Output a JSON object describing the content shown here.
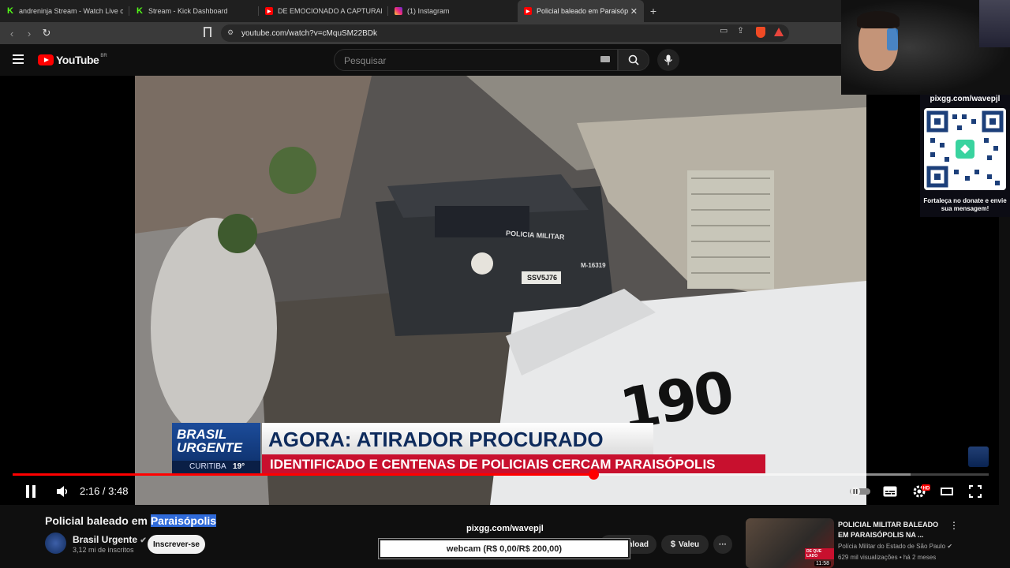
{
  "browser": {
    "tabs": [
      {
        "label": "andreninja Stream - Watch Live on K",
        "icon": "kick-icon"
      },
      {
        "label": "Stream - Kick Dashboard",
        "icon": "kick-icon"
      },
      {
        "label": "DE EMOCIONADO A CAPTURADO, A",
        "icon": "youtube-icon"
      },
      {
        "label": "(1) Instagram",
        "icon": "instagram-icon"
      },
      {
        "label": "Policial baleado em Paraisóp",
        "icon": "youtube-icon",
        "active": true
      }
    ],
    "url": "youtube.com/watch?v=cMquSM22BDk"
  },
  "youtube": {
    "logo": "YouTube",
    "region": "BR",
    "search_placeholder": "Pesquisar"
  },
  "video": {
    "lower_third": {
      "brand_line1": "BRASIL",
      "brand_line2": "URGENTE",
      "city": "CURITIBA",
      "temp": "19°",
      "headline": "AGORA: ATIRADOR PROCURADO",
      "subhead": "IDENTIFICADO E CENTENAS DE POLICIAIS CERCAM PARAISÓPOLIS"
    },
    "scene_text": {
      "car_door": "POLICIA MILITAR",
      "car_plate": "SSV5J76",
      "car_id": "M-16319",
      "car_number": "190"
    },
    "time_current": "2:16",
    "time_total": "3:48",
    "progress_fraction": 0.595,
    "buffered_fraction": 0.92
  },
  "overlay": {
    "donate_url": "pixgg.com/wavepjl",
    "donate_message": "Fortaleça no donate e envie sua mensagem!"
  },
  "below": {
    "title_plain": "Policial baleado em ",
    "title_highlight": "Paraisópolis",
    "channel_name": "Brasil Urgente",
    "channel_subs": "3,12 mi de inscritos",
    "subscribe_label": "Inscrever-se",
    "pix_label": "pixgg.com/wavepjl",
    "goal_label": "webcam (R$ 0,00/R$ 200,00)",
    "download_label": "nload",
    "thanks_label": "Valeu",
    "more_label": "···"
  },
  "related": {
    "title": "POLICIAL MILITAR BALEADO EM PARAISÓPOLIS NA ...",
    "channel": "Polícia Militar do Estado de São Paulo",
    "meta": "629 mil visualizações • há 2 meses",
    "duration": "11:58",
    "badge": "DE QUE LADO"
  },
  "colors": {
    "accent_red": "#ff0000",
    "lower_third_blue": "#1c4c9a",
    "lower_third_red": "#c8102e"
  }
}
